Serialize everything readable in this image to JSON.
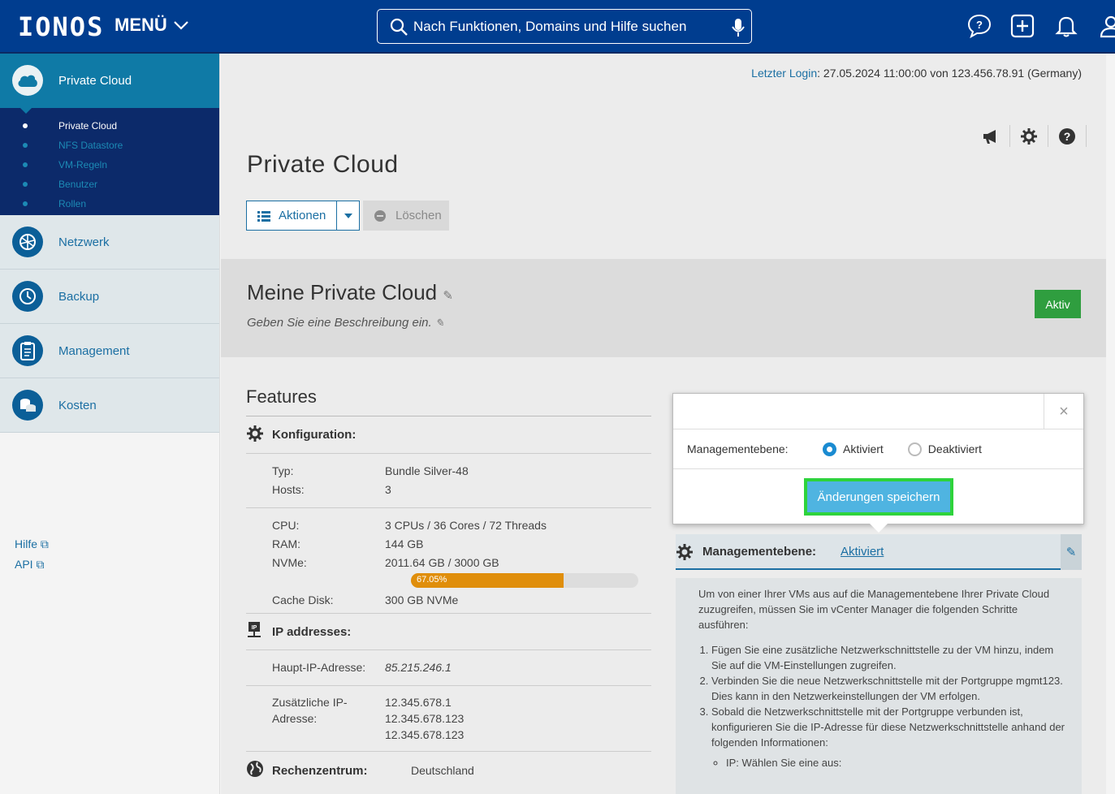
{
  "header": {
    "logo": "IONOS",
    "menu_label": "MENÜ",
    "search_placeholder": "Nach Funktionen, Domains und Hilfe suchen"
  },
  "sidebar": {
    "active_item": "Private Cloud",
    "sub_items": [
      "Private Cloud",
      "NFS Datastore",
      "VM-Regeln",
      "Benutzer",
      "Rollen"
    ],
    "items": [
      "Netzwerk",
      "Backup",
      "Management",
      "Kosten"
    ],
    "help": "Hilfe",
    "api": "API"
  },
  "last_login": {
    "label": "Letzter Login",
    "value": ": 27.05.2024 11:00:00 von 123.456.78.91 (Germany)"
  },
  "page": {
    "title": "Private Cloud",
    "actions": "Aktionen",
    "delete": "Löschen"
  },
  "cloud": {
    "name": "Meine Private Cloud",
    "description": "Geben Sie eine Beschreibung ein.",
    "status": "Aktiv"
  },
  "features": {
    "title": "Features",
    "config_label": "Konfiguration:",
    "type_label": "Typ:",
    "type_value": "Bundle Silver-48",
    "hosts_label": "Hosts:",
    "hosts_value": "3",
    "cpu_label": "CPU:",
    "cpu_value": "3 CPUs / 36 Cores / 72 Threads",
    "ram_label": "RAM:",
    "ram_value": "144 GB",
    "nvme_label": "NVMe:",
    "nvme_value": "2011.64 GB / 3000 GB",
    "nvme_usage": "67.05%",
    "nvme_fraction": 0.6705,
    "cache_label": "Cache Disk:",
    "cache_value": "300 GB NVMe",
    "ip_label": "IP addresses:",
    "main_ip_label": "Haupt-IP-Adresse:",
    "main_ip_value": "85.215.246.1",
    "extra_ip_label_1": "Zusätzliche IP-",
    "extra_ip_label_2": "Adresse:",
    "extra_ips": [
      "12.345.678.1",
      "12.345.678.123",
      "12.345.678.123"
    ],
    "dc_label": "Rechenzentrum:",
    "dc_value": "Deutschland"
  },
  "management": {
    "label": "Managementebene:",
    "value": "Aktiviert",
    "intro": "Um von einer Ihrer VMs aus auf die Managementebene Ihrer Private Cloud zuzugreifen, müssen Sie im vCenter Manager die folgenden Schritte ausführen:",
    "steps": [
      "Fügen Sie eine zusätzliche Netzwerkschnittstelle zu der VM hinzu, indem Sie auf die VM-Einstellungen zugreifen.",
      "Verbinden Sie die neue Netzwerkschnittstelle mit der Portgruppe mgmt123. Dies kann in den Netzwerkeinstellungen der VM erfolgen.",
      "Sobald die Netzwerkschnittstelle mit der Portgruppe verbunden ist, konfigurieren Sie die IP-Adresse für diese Netzwerkschnittstelle anhand der folgenden Informationen:"
    ],
    "sub_step": "IP: Wählen Sie eine aus:"
  },
  "popover": {
    "label": "Managementebene:",
    "option_on": "Aktiviert",
    "option_off": "Deaktiviert",
    "selected": "Aktiviert",
    "save": "Änderungen speichern",
    "close": "×"
  },
  "colors": {
    "header": "#003d8f",
    "accent": "#1b6fa3",
    "status_green": "#2f9e3f",
    "highlight": "#2ed33c",
    "save_button": "#4fb4e1",
    "progress": "#e08e0b"
  }
}
